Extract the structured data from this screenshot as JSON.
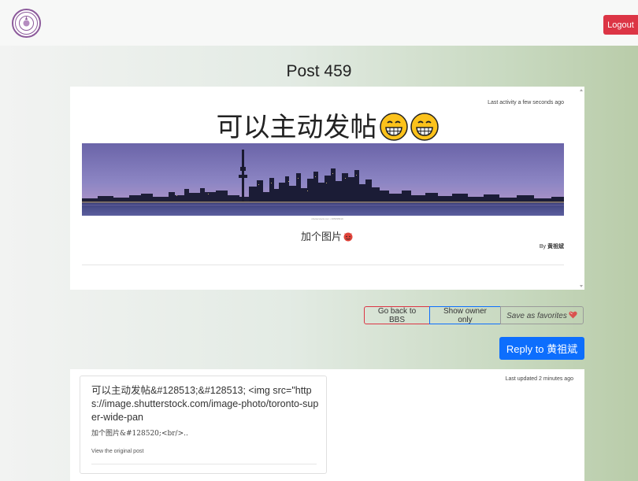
{
  "header": {
    "logout_label": "Logout"
  },
  "page_title": "Post 459",
  "post": {
    "last_activity": "Last activity a few seconds ago",
    "heading": "可以主动发帖",
    "banner_credit": "shutterstock.com • 365095619",
    "caption": "加个图片",
    "byline_prefix": "By",
    "author": "黄祖斌"
  },
  "actions": {
    "back_label": "Go back to BBS",
    "owner_label": "Show owner only",
    "favorites_label": "Save as favorites",
    "reply_label": "Reply to 黄祖斌"
  },
  "reply_section": {
    "last_updated": "Last updated 2 minutes ago",
    "quote_cn": "可以主动发帖",
    "quote_rest": "&#128513;&#128513; <img src=\"https://image.shutterstock.com/image-photo/toronto-super-wide-pan",
    "quote_line2": "加个图片&#128520;<br/>..",
    "view_original": "View the original post"
  },
  "colors": {
    "logout": "#dc3545",
    "primary": "#0d6efd",
    "logo_ring": "#8c5a9b"
  },
  "icons": {
    "logo": "university-seal-icon",
    "grin_emoji": "grinning-face-emoji",
    "devil_emoji": "smiling-devil-emoji",
    "heart": "heart-icon"
  }
}
